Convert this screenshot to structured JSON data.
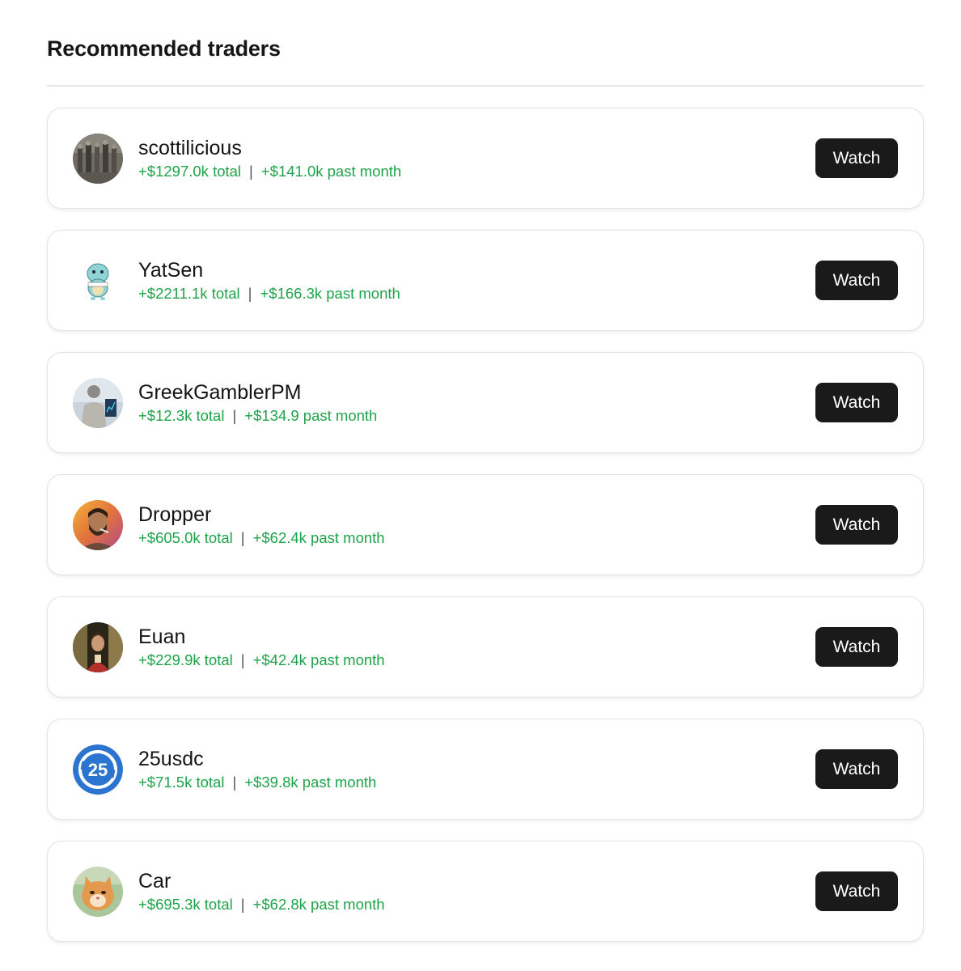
{
  "page": {
    "title": "Recommended traders"
  },
  "colors": {
    "accent_green": "#1fa34a",
    "button_bg": "#1a1a1a",
    "button_text": "#ffffff"
  },
  "traders": [
    {
      "name": "scottilicious",
      "total": "+$1297.0k total",
      "separator": "|",
      "month": "+$141.0k past month",
      "watch_label": "Watch",
      "avatar_icon": "crowd-photo-avatar"
    },
    {
      "name": "YatSen",
      "total": "+$2211.1k total",
      "separator": "|",
      "month": "+$166.3k past month",
      "watch_label": "Watch",
      "avatar_icon": "squirtle-avatar"
    },
    {
      "name": "GreekGamblerPM",
      "total": "+$12.3k total",
      "separator": "|",
      "month": "+$134.9 past month",
      "watch_label": "Watch",
      "avatar_icon": "statue-avatar"
    },
    {
      "name": "Dropper",
      "total": "+$605.0k total",
      "separator": "|",
      "month": "+$62.4k past month",
      "watch_label": "Watch",
      "avatar_icon": "bearded-man-avatar"
    },
    {
      "name": "Euan",
      "total": "+$229.9k total",
      "separator": "|",
      "month": "+$42.4k past month",
      "watch_label": "Watch",
      "avatar_icon": "portrait-avatar"
    },
    {
      "name": "25usdc",
      "total": "+$71.5k total",
      "separator": "|",
      "month": "+$39.8k past month",
      "watch_label": "Watch",
      "avatar_icon": "blue-25-badge-avatar"
    },
    {
      "name": "Car",
      "total": "+$695.3k total",
      "separator": "|",
      "month": "+$62.8k past month",
      "watch_label": "Watch",
      "avatar_icon": "cat-avatar"
    }
  ]
}
